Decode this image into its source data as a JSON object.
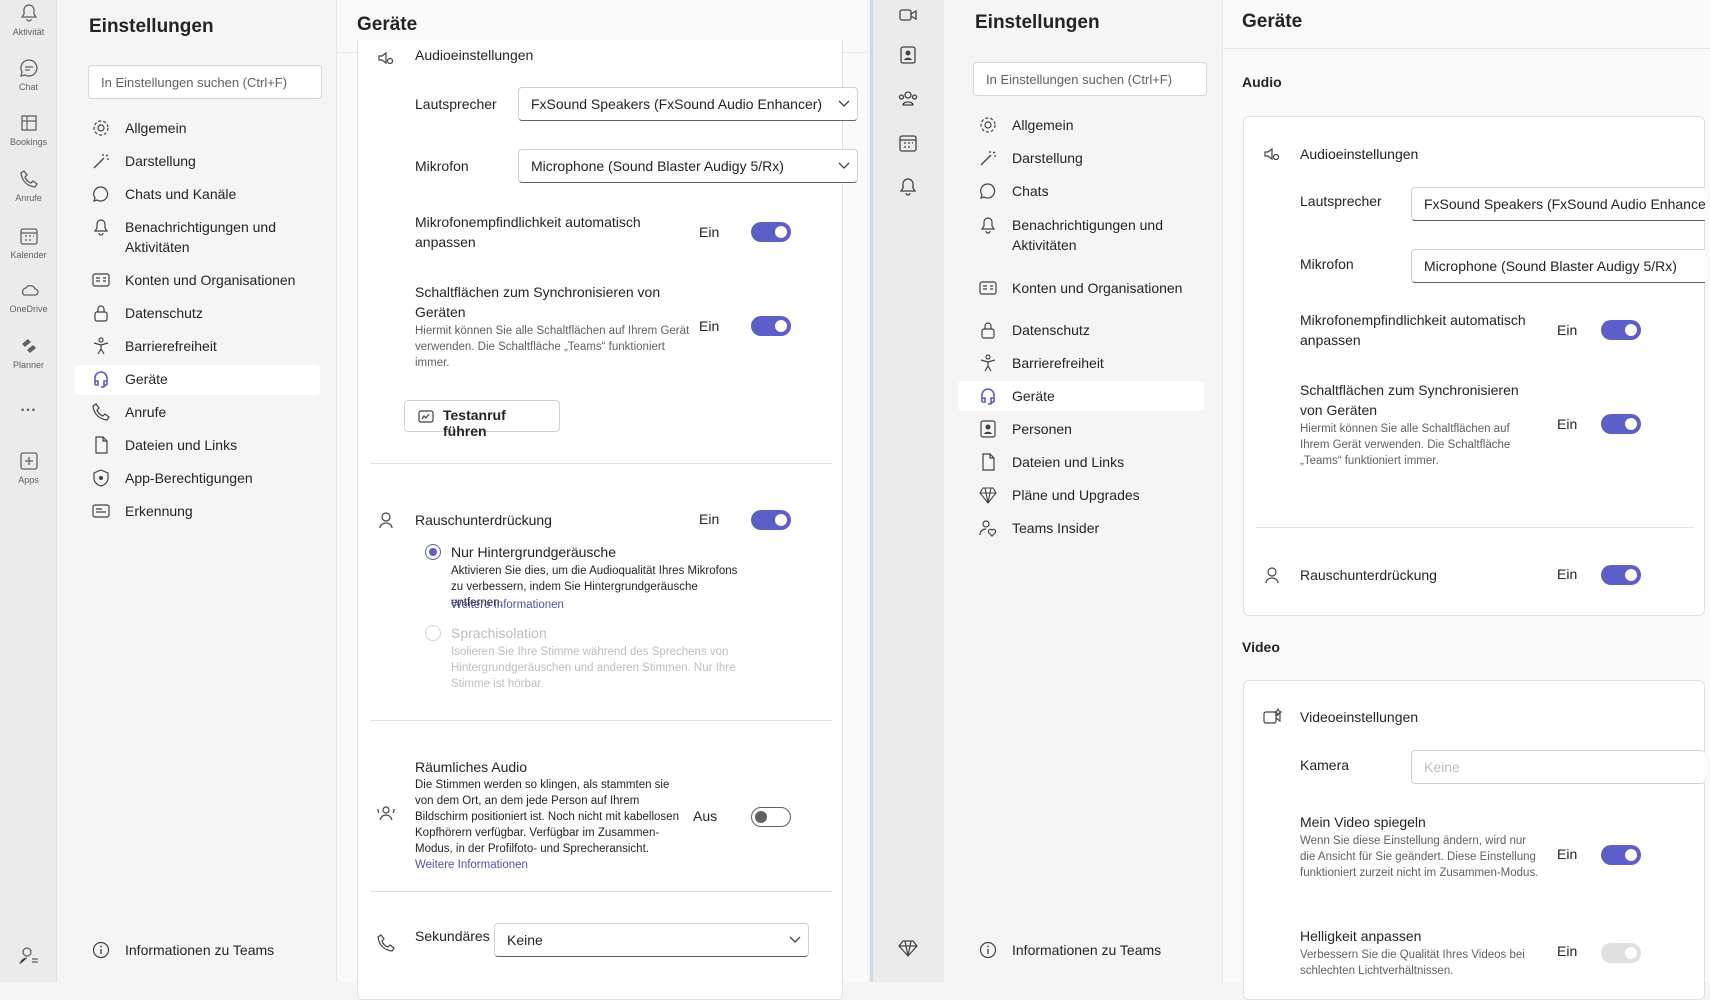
{
  "left_rail": [
    {
      "name": "activity",
      "label": "Aktivität"
    },
    {
      "name": "chat",
      "label": "Chat"
    },
    {
      "name": "bookings",
      "label": "Bookings"
    },
    {
      "name": "calls",
      "label": "Anrufe"
    },
    {
      "name": "calendar",
      "label": "Kalender"
    },
    {
      "name": "onedrive",
      "label": "OneDrive"
    },
    {
      "name": "planner",
      "label": "Planner"
    },
    {
      "name": "more",
      "label": "..."
    },
    {
      "name": "apps",
      "label": "Apps"
    }
  ],
  "left_nav": {
    "title": "Einstellungen",
    "search_placeholder": "In Einstellungen suchen (Ctrl+F)",
    "items": [
      "Allgemein",
      "Darstellung",
      "Chats und Kanäle",
      "Benachrichtigungen und Aktivitäten",
      "Konten und Organisationen",
      "Datenschutz",
      "Barrierefreiheit",
      "Geräte",
      "Anrufe",
      "Dateien und Links",
      "App-Berechtigungen",
      "Erkennung"
    ],
    "selected": "Geräte",
    "about": "Informationen zu Teams"
  },
  "left_main": {
    "title": "Geräte",
    "audio_settings": "Audioeinstellungen",
    "speaker_label": "Lautsprecher",
    "speaker_value": "FxSound Speakers (FxSound Audio Enhancer)",
    "mic_label": "Mikrofon",
    "mic_value": "Microphone (Sound Blaster Audigy 5/Rx)",
    "auto_adjust_label": "Mikrofonempfindlichkeit automatisch anpassen",
    "auto_adjust_state": "Ein",
    "sync_label": "Schaltflächen zum Synchronisieren von Geräten",
    "sync_desc": "Hiermit können Sie alle Schaltflächen auf Ihrem Gerät verwenden. Die Schaltfläche „Teams“ funktioniert immer.",
    "sync_state": "Ein",
    "test_call_button": "Testanruf führen",
    "noise_label": "Rauschunterdrückung",
    "noise_state": "Ein",
    "radio_background": "Nur Hintergrundgeräusche",
    "radio_background_desc": "Aktivieren Sie dies, um die Audioqualität Ihres Mikrofons zu verbessern, indem Sie Hintergrundgeräusche entfernen.",
    "more_info": "Weitere Informationen",
    "radio_voice": "Sprachisolation",
    "radio_voice_desc": "Isolieren Sie Ihre Stimme während des Sprechens von Hintergrundgeräuschen und anderen Stimmen. Nur Ihre Stimme ist hörbar.",
    "spatial_label": "Räumliches Audio",
    "spatial_desc": "Die Stimmen werden so klingen, als stammten sie von dem Ort, an dem jede Person auf Ihrem Bildschirm positioniert ist. Noch nicht mit kabellosen Kopfhörern verfügbar. Verfügbar im Zusammen-Modus, in der Profilfoto- und Sprecheransicht.",
    "spatial_link1": "Weitere",
    "spatial_link2": "Informationen",
    "spatial_state": "Aus",
    "secondary_label": "Sekundäres",
    "secondary_value": "Keine"
  },
  "right_rail": [
    "video-icon",
    "contacts-icon",
    "teams-icon",
    "calendar-icon",
    "bell-icon",
    "diamond-icon"
  ],
  "right_nav": {
    "title": "Einstellungen",
    "search_placeholder": "In Einstellungen suchen (Ctrl+F)",
    "items": [
      "Allgemein",
      "Darstellung",
      "Chats",
      "Benachrichtigungen und Aktivitäten",
      "Konten und Organisationen",
      "Datenschutz",
      "Barrierefreiheit",
      "Geräte",
      "Personen",
      "Dateien und Links",
      "Pläne und Upgrades",
      "Teams Insider"
    ],
    "selected": "Geräte",
    "about": "Informationen zu Teams"
  },
  "right_main": {
    "title": "Geräte",
    "audio_section": "Audio",
    "audio_settings": "Audioeinstellungen",
    "speaker_label": "Lautsprecher",
    "speaker_value": "FxSound Speakers (FxSound Audio Enhance",
    "mic_label": "Mikrofon",
    "mic_value": "Microphone (Sound Blaster Audigy 5/Rx)",
    "auto_adjust_label": "Mikrofonempfindlichkeit automatisch anpassen",
    "auto_adjust_state": "Ein",
    "sync_label": "Schaltflächen zum Synchronisieren von Geräten",
    "sync_desc": "Hiermit können Sie alle Schaltflächen auf Ihrem Gerät verwenden. Die Schaltfläche „Teams“ funktioniert immer.",
    "sync_state": "Ein",
    "noise_label": "Rauschunterdrückung",
    "noise_state": "Ein",
    "video_section": "Video",
    "video_settings": "Videoeinstellungen",
    "camera_label": "Kamera",
    "camera_placeholder": "Keine",
    "mirror_label": "Mein Video spiegeln",
    "mirror_desc": "Wenn Sie diese Einstellung ändern, wird nur die Ansicht für Sie geändert. Diese Einstellung funktioniert zurzeit nicht im Zusammen-Modus.",
    "mirror_state": "Ein",
    "brightness_label": "Helligkeit anpassen",
    "brightness_desc": "Verbessern Sie die Qualität Ihres Videos bei schlechten Lichtverhältnissen.",
    "brightness_state": "Ein"
  },
  "colors": {
    "accent": "#5b5fc7",
    "link": "#4f52b2"
  }
}
